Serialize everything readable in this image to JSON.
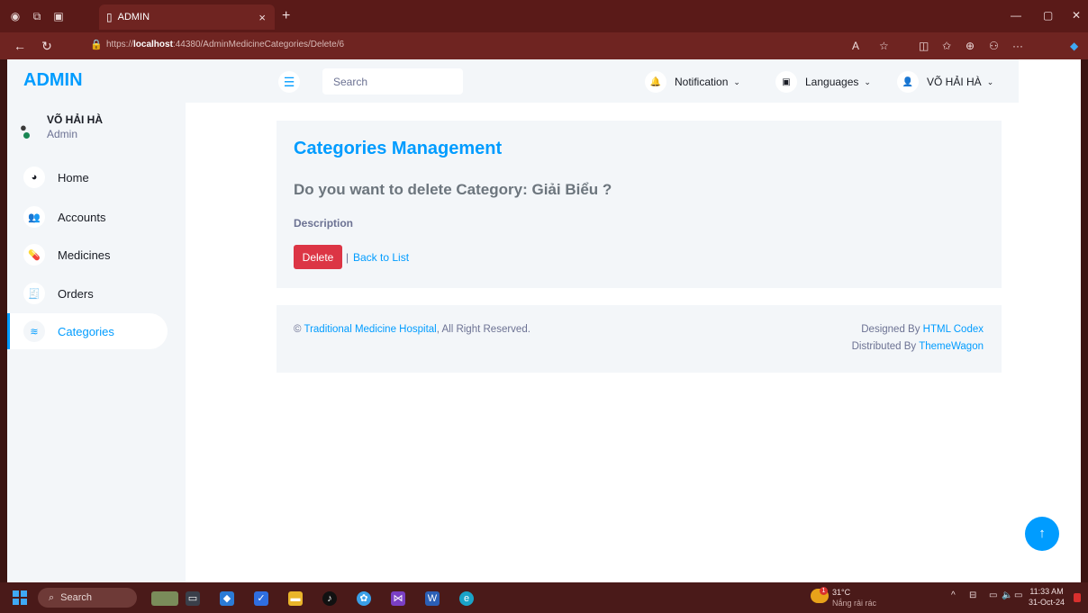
{
  "browser": {
    "tab_title": "ADMIN",
    "tab_close": "×",
    "new_tab": "+",
    "url_prefix": "https://",
    "url_host": "localhost",
    "url_rest": ":44380/AdminMedicineCategories/Delete/6",
    "read_aloud": "A",
    "window_min": "—",
    "window_restore": "▢",
    "window_close": "✕"
  },
  "sidebar": {
    "brand": "ADMIN",
    "user_name": "VÕ HẢI HÀ",
    "user_role": "Admin",
    "items": [
      {
        "label": "Home",
        "icon": "tachometer-icon",
        "glyph": "◕"
      },
      {
        "label": "Accounts",
        "icon": "users-icon",
        "glyph": "👥"
      },
      {
        "label": "Medicines",
        "icon": "pills-icon",
        "glyph": "💊"
      },
      {
        "label": "Orders",
        "icon": "receipt-icon",
        "glyph": "🧾"
      },
      {
        "label": "Categories",
        "icon": "layers-icon",
        "glyph": "≋"
      }
    ],
    "active_item": "Categories"
  },
  "topnav": {
    "toggle_glyph": "☰",
    "search_placeholder": "Search",
    "notification_label": "Notification",
    "languages_label": "Languages",
    "user_label": "VÕ HẢI HÀ",
    "chevron": "⌄"
  },
  "page": {
    "title": "Categories Management",
    "question": "Do you want to delete Category: Giải Biểu ?",
    "description_label": "Description",
    "delete_button": "Delete",
    "separator": "|",
    "back_link": "Back to List"
  },
  "footer": {
    "copyright_symbol": "©",
    "site_name": "Traditional Medicine Hospital",
    "rights_text": ", All Right Reserved.",
    "designed_by_text": "Designed By",
    "designer": "HTML Codex",
    "distributed_by_text": "Distributed By",
    "distributor": "ThemeWagon"
  },
  "back_to_top_glyph": "↑",
  "taskbar": {
    "search_label": "Search",
    "weather_temp": "31°C",
    "weather_desc": "Nắng rải rác",
    "weather_badge": "1",
    "time": "11:33 AM",
    "date": "31-Oct-24",
    "tray_chevron": "^"
  },
  "colors": {
    "accent": "#009cff",
    "danger": "#dc3545",
    "panel": "#f3f6f9",
    "chrome": "#6f2421"
  }
}
